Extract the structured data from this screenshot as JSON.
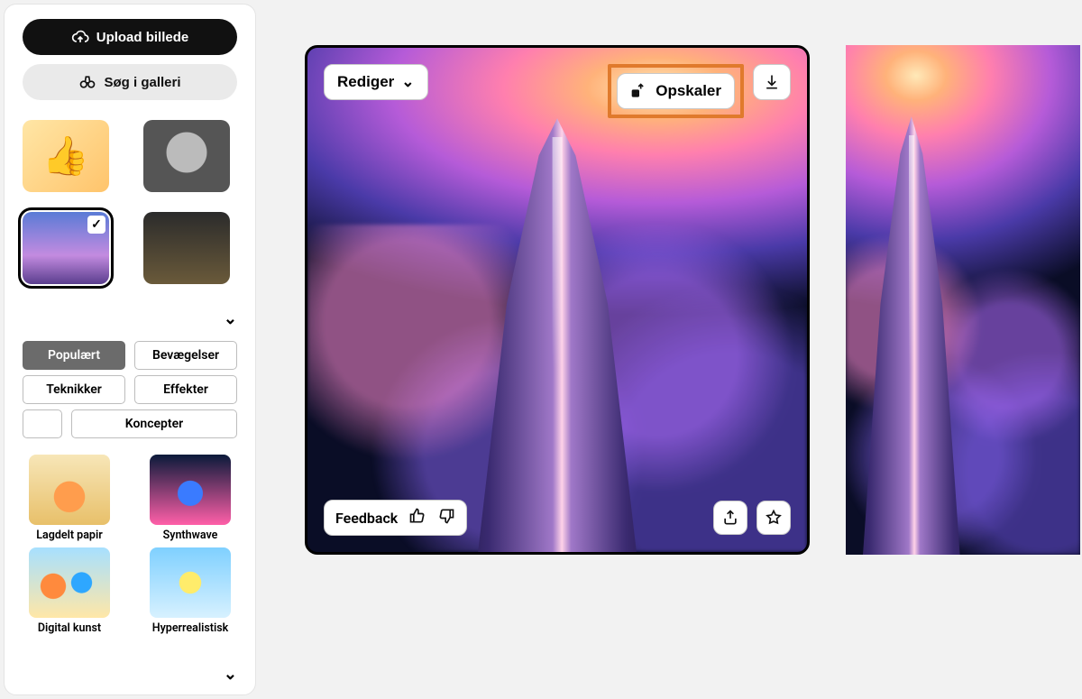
{
  "sidebar": {
    "upload_label": "Upload billede",
    "gallery_label": "Søg i galleri",
    "tabs": {
      "popular": "Populært",
      "movements": "Bevægelser",
      "techniques": "Teknikker",
      "effects": "Effekter",
      "concepts": "Koncepter"
    },
    "styles": [
      {
        "label": "Lagdelt papir"
      },
      {
        "label": "Synthwave"
      },
      {
        "label": "Digital kunst"
      },
      {
        "label": "Hyperrealistisk"
      }
    ]
  },
  "canvas": {
    "edit_label": "Rediger",
    "upscale_label": "Opskaler",
    "feedback_label": "Feedback"
  }
}
